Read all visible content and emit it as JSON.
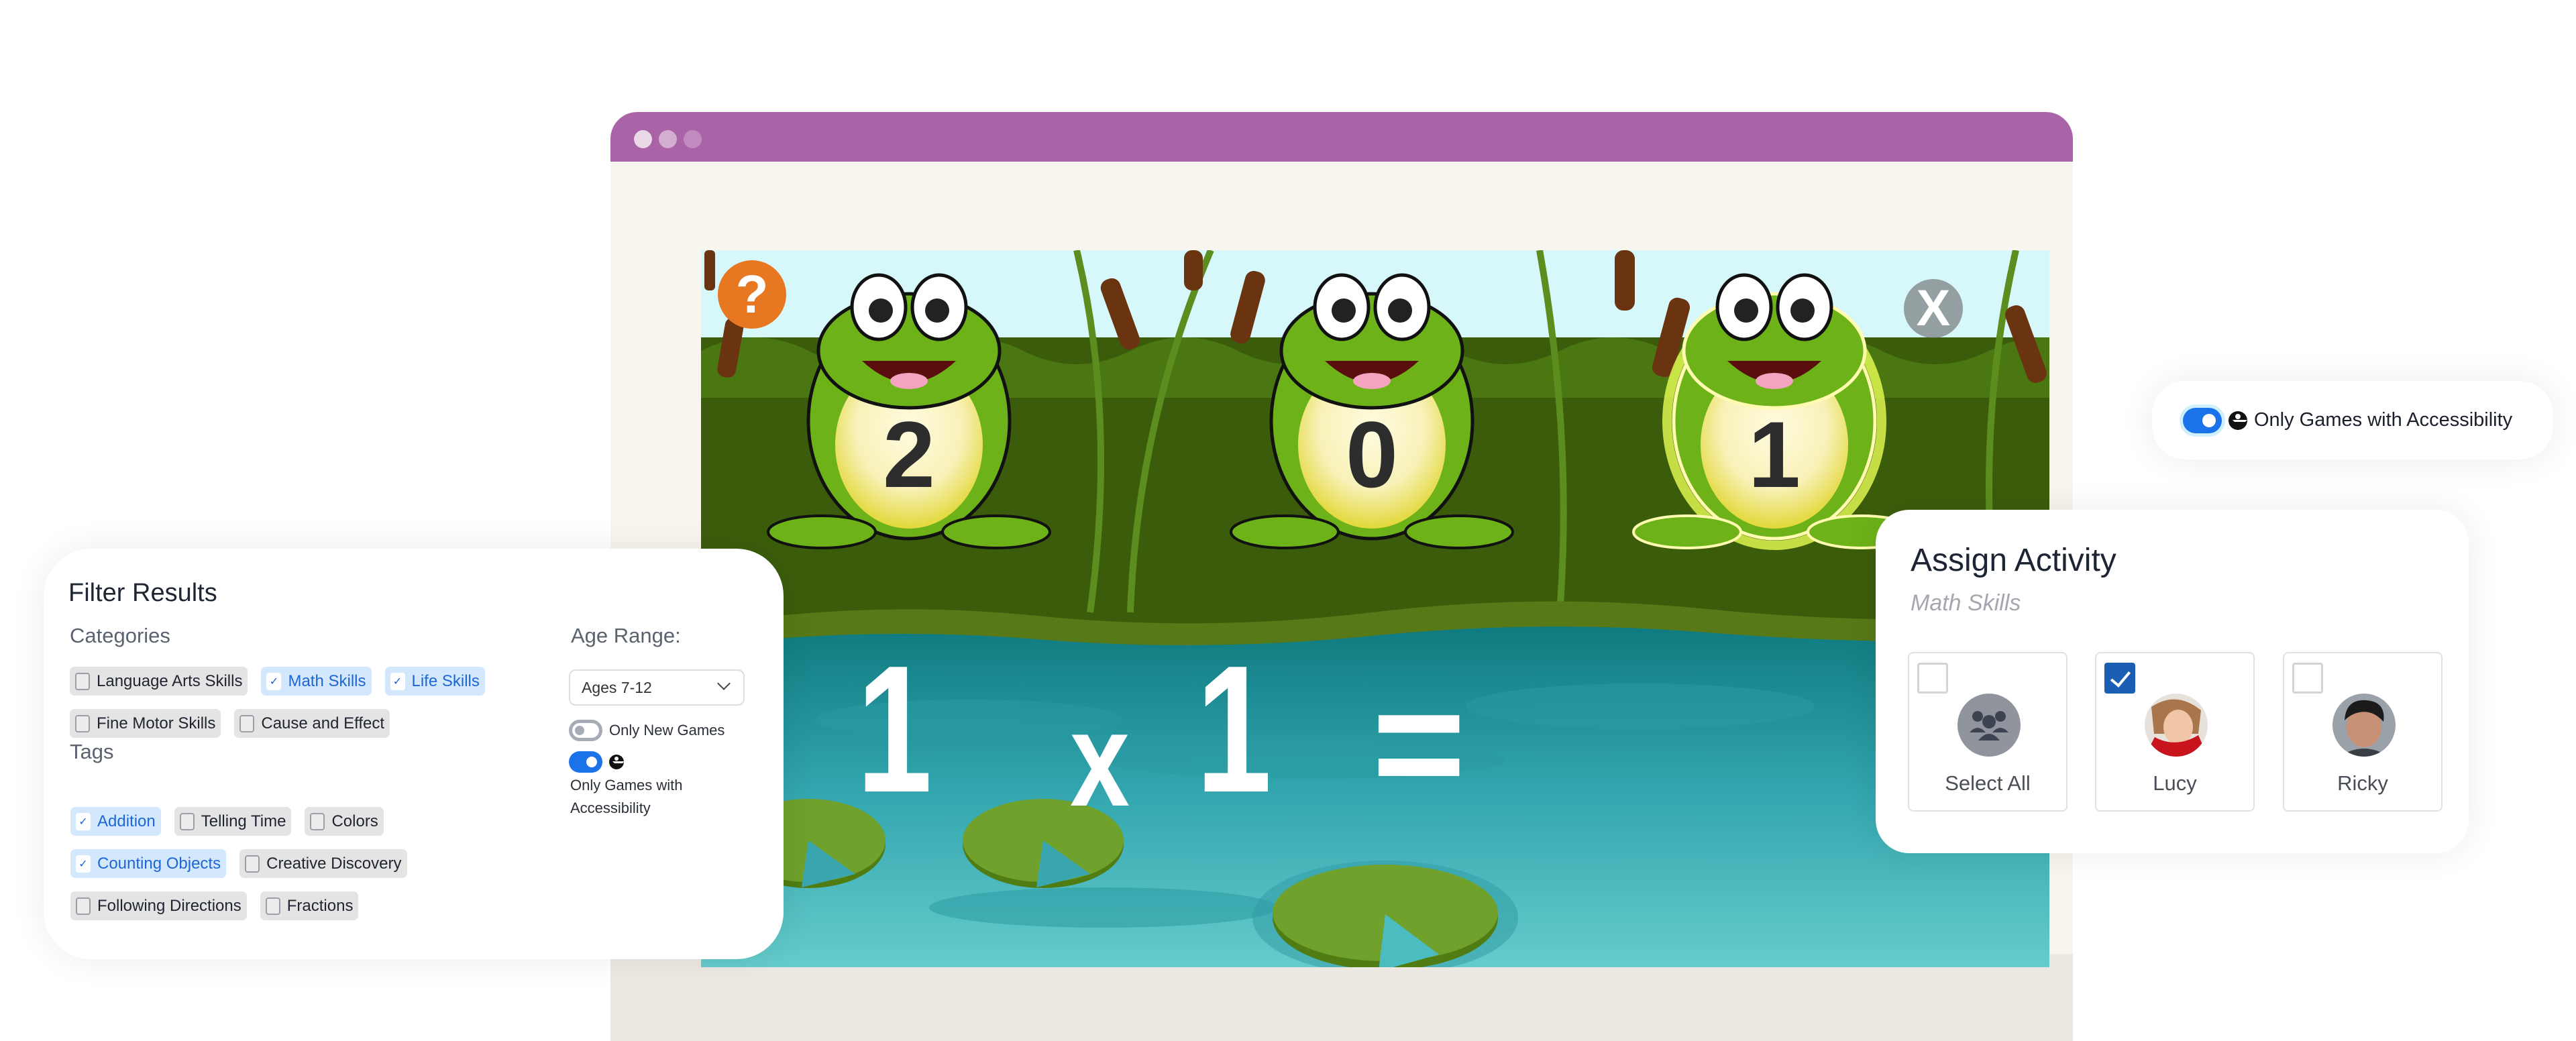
{
  "window": {
    "title_dots": [
      "close",
      "minimize",
      "maximize"
    ],
    "accent_color": "#ab63a8"
  },
  "game": {
    "help_label": "?",
    "close_label": "X",
    "frogs": [
      {
        "number": "2",
        "highlighted": false
      },
      {
        "number": "0",
        "highlighted": false
      },
      {
        "number": "1",
        "highlighted": true
      }
    ],
    "equation": {
      "left": "1",
      "operator": "x",
      "right": "1",
      "equals": "="
    }
  },
  "filter": {
    "title": "Filter Results",
    "categories_label": "Categories",
    "categories": [
      {
        "label": "Language Arts Skills",
        "checked": false
      },
      {
        "label": "Math Skills",
        "checked": true
      },
      {
        "label": "Life Skills",
        "checked": true
      },
      {
        "label": "Fine Motor Skills",
        "checked": false
      },
      {
        "label": "Cause and Effect",
        "checked": false
      }
    ],
    "tags_label": "Tags",
    "tags": [
      {
        "label": "Addition",
        "checked": true
      },
      {
        "label": "Telling Time",
        "checked": false
      },
      {
        "label": "Colors",
        "checked": false
      },
      {
        "label": "Counting Objects",
        "checked": true
      },
      {
        "label": "Creative Discovery",
        "checked": false
      },
      {
        "label": "Following Directions",
        "checked": false
      },
      {
        "label": "Fractions",
        "checked": false
      }
    ],
    "age_range_label": "Age Range:",
    "age_range_value": "Ages 7-12",
    "toggles": [
      {
        "label": "Only New Games",
        "on": false,
        "icon": null
      },
      {
        "label": "Only Games with Accessibility",
        "on": true,
        "icon": "accessibility-icon"
      }
    ],
    "check_glyph": "✓"
  },
  "accessibility_pill": {
    "label": "Only Games with Accessibility",
    "on": true,
    "icon": "accessibility-icon"
  },
  "assign": {
    "title": "Assign Activity",
    "subtitle": "Math Skills",
    "students": [
      {
        "name": "Select All",
        "checked": false,
        "avatar": "group-icon"
      },
      {
        "name": "Lucy",
        "checked": true,
        "avatar": "photo"
      },
      {
        "name": "Ricky",
        "checked": false,
        "avatar": "photo"
      }
    ],
    "checked_color": "#1a5fb4"
  }
}
